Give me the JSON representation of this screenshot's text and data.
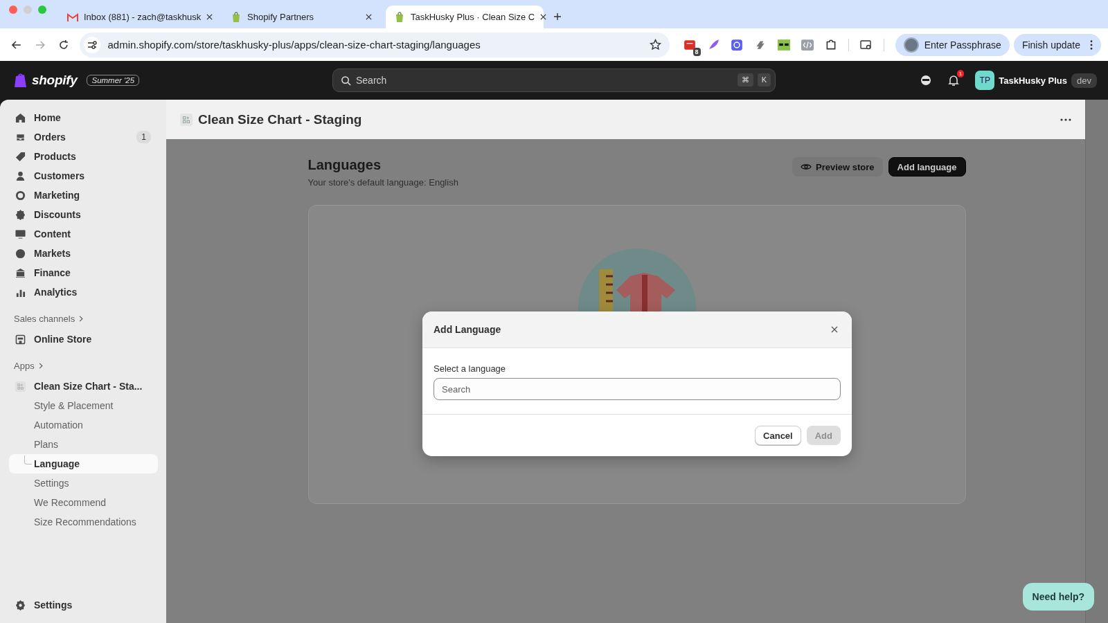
{
  "browser": {
    "tabs": [
      {
        "title": "Inbox (881) - zach@taskhusk",
        "selected": false,
        "kind": "mail"
      },
      {
        "title": "Shopify Partners",
        "selected": false,
        "kind": "shop"
      },
      {
        "title": "TaskHusky Plus · Clean Size C",
        "selected": true,
        "kind": "shop"
      }
    ],
    "url": "admin.shopify.com/store/taskhusky-plus/apps/clean-size-chart-staging/languages",
    "extension_badge": "8",
    "profile_button": "Enter Passphrase",
    "update_button": "Finish update"
  },
  "topbar": {
    "logo": "shopify",
    "edition": "Summer '25",
    "search": {
      "placeholder": "Search"
    },
    "shortcut_keys": [
      "⌘",
      "K"
    ],
    "notification_count": "1",
    "store_avatar": "TP",
    "store_name": "TaskHusky Plus",
    "store_badge": "dev"
  },
  "sidebar": {
    "items": [
      {
        "label": "Home"
      },
      {
        "label": "Orders",
        "badge": "1"
      },
      {
        "label": "Products"
      },
      {
        "label": "Customers"
      },
      {
        "label": "Marketing"
      },
      {
        "label": "Discounts"
      },
      {
        "label": "Content"
      },
      {
        "label": "Markets"
      },
      {
        "label": "Finance"
      },
      {
        "label": "Analytics"
      }
    ],
    "sales_channels_heading": "Sales channels",
    "sales_channels": [
      {
        "label": "Online Store"
      }
    ],
    "apps_heading": "Apps",
    "app": {
      "name": "Clean Size Chart - Sta...",
      "children": [
        {
          "label": "Style & Placement",
          "selected": false
        },
        {
          "label": "Automation",
          "selected": false
        },
        {
          "label": "Plans",
          "selected": false
        },
        {
          "label": "Language",
          "selected": true
        },
        {
          "label": "Settings",
          "selected": false
        },
        {
          "label": "We Recommend",
          "selected": false
        },
        {
          "label": "Size Recommendations",
          "selected": false
        }
      ]
    },
    "settings": "Settings"
  },
  "page_header": {
    "title": "Clean Size Chart - Staging"
  },
  "content": {
    "title": "Languages",
    "subtitle": "Your store's default language: English",
    "preview_button": "Preview store",
    "add_button": "Add language"
  },
  "modal": {
    "title": "Add Language",
    "field_label": "Select a language",
    "placeholder": "Search",
    "cancel_button": "Cancel",
    "add_button": "Add",
    "add_disabled": true
  },
  "help_button": "Need help?"
}
